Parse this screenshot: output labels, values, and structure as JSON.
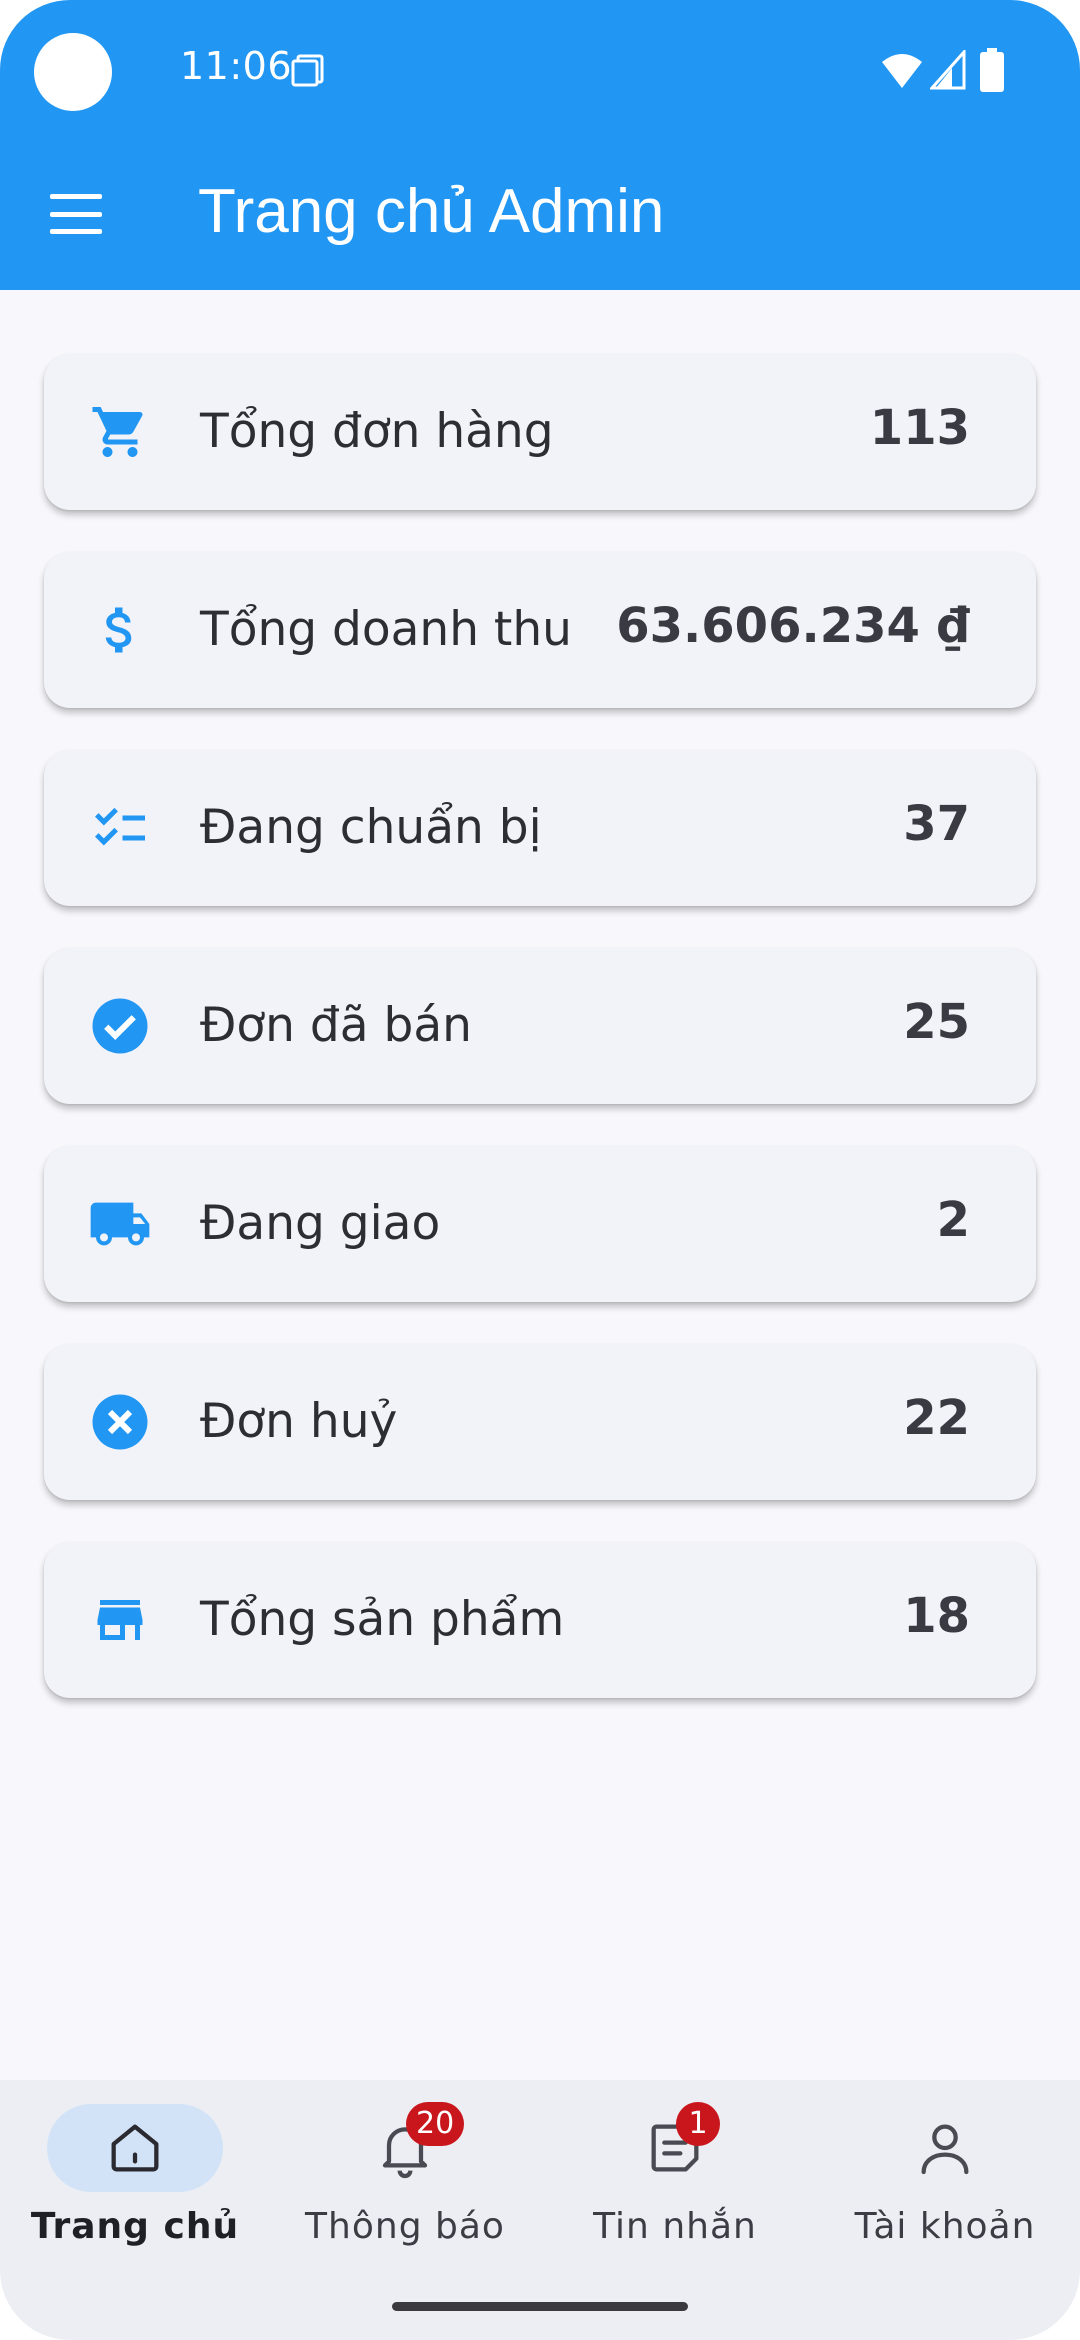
{
  "status_bar": {
    "time": "11:06"
  },
  "app_bar": {
    "title": "Trang chủ Admin",
    "menu_icon": "menu-icon"
  },
  "colors": {
    "primary": "#2196f3",
    "card_bg": "#f2f3f8",
    "badge": "#c8161c",
    "nav_active_bg": "#d2e3f7"
  },
  "stats": [
    {
      "icon": "shopping-cart-icon",
      "label": "Tổng đơn hàng",
      "value": "113"
    },
    {
      "icon": "dollar-icon",
      "label": "Tổng doanh thu",
      "value": "63.606.234 ₫"
    },
    {
      "icon": "checklist-icon",
      "label": "Đang chuẩn bị",
      "value": "37"
    },
    {
      "icon": "check-circle-icon",
      "label": "Đơn đã bán",
      "value": "25"
    },
    {
      "icon": "delivery-truck-icon",
      "label": "Đang giao",
      "value": "2"
    },
    {
      "icon": "cancel-circle-icon",
      "label": "Đơn huỷ",
      "value": "22"
    },
    {
      "icon": "store-icon",
      "label": "Tổng sản phẩm",
      "value": "18"
    }
  ],
  "bottom_nav": {
    "items": [
      {
        "icon": "home-icon",
        "label": "Trang chủ",
        "active": true
      },
      {
        "icon": "bell-icon",
        "label": "Thông báo",
        "badge": "20"
      },
      {
        "icon": "message-icon",
        "label": "Tin nhắn",
        "badge": "1"
      },
      {
        "icon": "person-icon",
        "label": "Tài khoản"
      }
    ]
  }
}
